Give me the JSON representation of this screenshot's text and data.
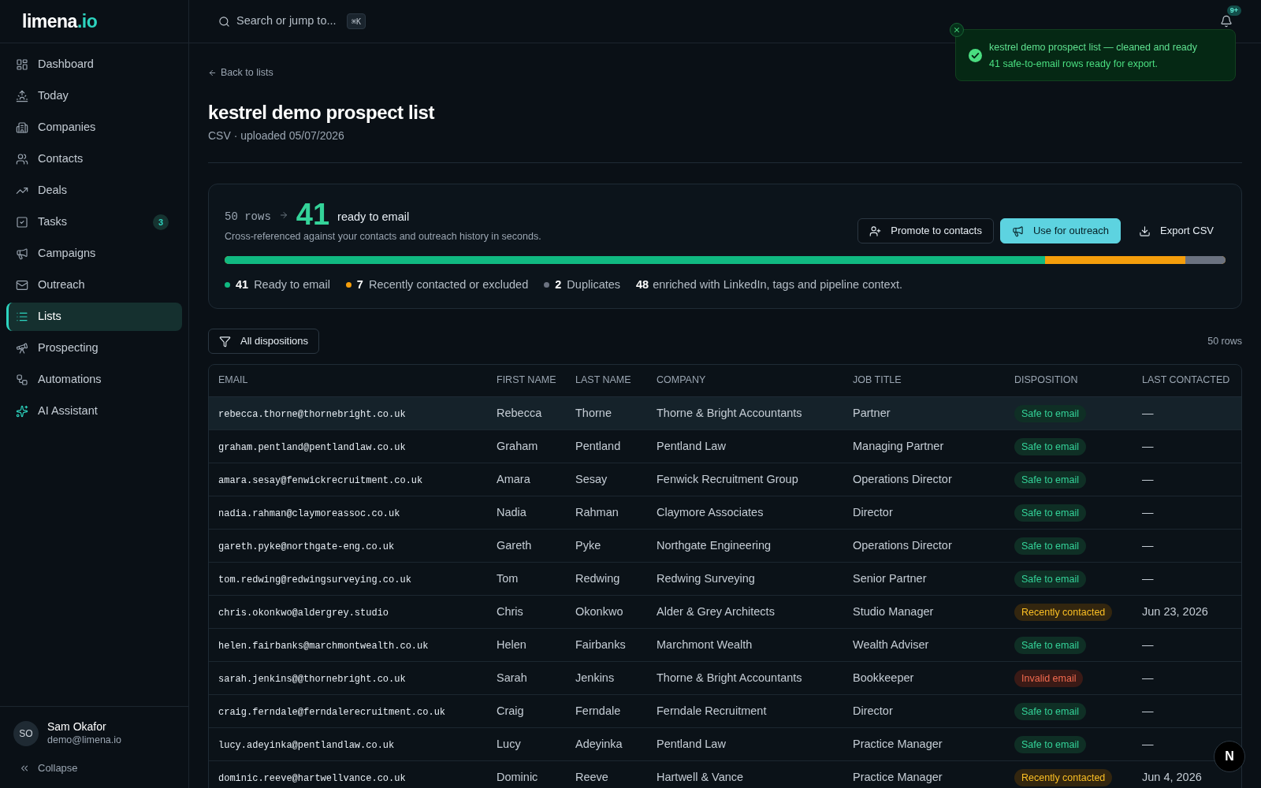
{
  "sidebar": {
    "logo": {
      "name": "limena",
      "suffix": ".io"
    },
    "items": [
      {
        "label": "Dashboard",
        "selected": false
      },
      {
        "label": "Today",
        "selected": false
      },
      {
        "label": "Companies",
        "selected": false
      },
      {
        "label": "Contacts",
        "selected": false
      },
      {
        "label": "Deals",
        "selected": false
      },
      {
        "label": "Tasks",
        "selected": false,
        "badge": "3"
      },
      {
        "label": "Campaigns",
        "selected": false
      },
      {
        "label": "Outreach",
        "selected": false
      },
      {
        "label": "Lists",
        "selected": true
      },
      {
        "label": "Prospecting",
        "selected": false
      },
      {
        "label": "Automations",
        "selected": false
      },
      {
        "label": "AI Assistant",
        "selected": false
      }
    ],
    "user": {
      "initials": "SO",
      "name": "Sam Okafor",
      "email": "demo@limena.io"
    },
    "collapse": "Collapse"
  },
  "topbar": {
    "search": {
      "placeholder": "Search or jump to..."
    },
    "shortcut": "⌘K",
    "notifications": "9+"
  },
  "toast": {
    "title": "kestrel demo prospect list — cleaned and ready",
    "message": "41 safe-to-email rows ready for export."
  },
  "page": {
    "back": "Back to lists",
    "title": "kestrel demo prospect list",
    "subtitle": "CSV · uploaded 05/07/2026"
  },
  "summary": {
    "total": "50 rows",
    "ready": "41",
    "ready_label": "ready to email",
    "note": "Cross-referenced against your contacts and outreach history in seconds.",
    "actions": [
      {
        "label": "Promote to contacts",
        "kind": "outline"
      },
      {
        "label": "Use for outreach",
        "kind": "primary"
      },
      {
        "label": "Export CSV",
        "kind": "ghost"
      }
    ],
    "segments": [
      {
        "count": "41",
        "label": "Ready to email",
        "color": "#10b981",
        "level": 0.82
      },
      {
        "count": "7",
        "label": "Recently contacted or excluded",
        "color": "#f59e0b"
      },
      {
        "count": "2",
        "label": "Duplicates",
        "color": "#6b7280",
        "level": 0.04
      }
    ],
    "enriched": {
      "count": "48",
      "label": "enriched with LinkedIn, tags and pipeline context."
    }
  },
  "filter": {
    "label": "All dispositions"
  },
  "row_count": "50 rows",
  "table": {
    "columns": [
      "EMAIL",
      "FIRST NAME",
      "LAST NAME",
      "COMPANY",
      "JOB TITLE",
      "DISPOSITION",
      "LAST CONTACTED"
    ],
    "rows": [
      {
        "selected": true,
        "email": "rebecca.thorne@thornebright.co.uk",
        "first_name": "Rebecca",
        "last_name": "Thorne",
        "company": "Thorne & Bright Accountants",
        "job_title": "Partner",
        "disposition": {
          "label": "Safe to email",
          "kind": "safe"
        },
        "last_contacted": "—"
      },
      {
        "selected": false,
        "email": "graham.pentland@pentlandlaw.co.uk",
        "first_name": "Graham",
        "last_name": "Pentland",
        "company": "Pentland Law",
        "job_title": "Managing Partner",
        "disposition": {
          "label": "Safe to email",
          "kind": "safe"
        },
        "last_contacted": "—"
      },
      {
        "selected": false,
        "email": "amara.sesay@fenwickrecruitment.co.uk",
        "first_name": "Amara",
        "last_name": "Sesay",
        "company": "Fenwick Recruitment Group",
        "job_title": "Operations Director",
        "disposition": {
          "label": "Safe to email",
          "kind": "safe"
        },
        "last_contacted": "—"
      },
      {
        "selected": false,
        "email": "nadia.rahman@claymoreassoc.co.uk",
        "first_name": "Nadia",
        "last_name": "Rahman",
        "company": "Claymore Associates",
        "job_title": "Director",
        "disposition": {
          "label": "Safe to email",
          "kind": "safe"
        },
        "last_contacted": "—"
      },
      {
        "selected": false,
        "email": "gareth.pyke@northgate-eng.co.uk",
        "first_name": "Gareth",
        "last_name": "Pyke",
        "company": "Northgate Engineering",
        "job_title": "Operations Director",
        "disposition": {
          "label": "Safe to email",
          "kind": "safe"
        },
        "last_contacted": "—"
      },
      {
        "selected": false,
        "email": "tom.redwing@redwingsurveying.co.uk",
        "first_name": "Tom",
        "last_name": "Redwing",
        "company": "Redwing Surveying",
        "job_title": "Senior Partner",
        "disposition": {
          "label": "Safe to email",
          "kind": "safe"
        },
        "last_contacted": "—"
      },
      {
        "selected": false,
        "email": "chris.okonkwo@aldergrey.studio",
        "first_name": "Chris",
        "last_name": "Okonkwo",
        "company": "Alder & Grey Architects",
        "job_title": "Studio Manager",
        "disposition": {
          "label": "Recently contacted",
          "kind": "recent"
        },
        "last_contacted": "Jun 23, 2026"
      },
      {
        "selected": false,
        "email": "helen.fairbanks@marchmontwealth.co.uk",
        "first_name": "Helen",
        "last_name": "Fairbanks",
        "company": "Marchmont Wealth",
        "job_title": "Wealth Adviser",
        "disposition": {
          "label": "Safe to email",
          "kind": "safe"
        },
        "last_contacted": "—"
      },
      {
        "selected": false,
        "email": "sarah.jenkins@@thornebright.co.uk",
        "first_name": "Sarah",
        "last_name": "Jenkins",
        "company": "Thorne & Bright Accountants",
        "job_title": "Bookkeeper",
        "disposition": {
          "label": "Invalid email",
          "kind": "invalid"
        },
        "last_contacted": "—"
      },
      {
        "selected": false,
        "email": "craig.ferndale@ferndalerecruitment.co.uk",
        "first_name": "Craig",
        "last_name": "Ferndale",
        "company": "Ferndale Recruitment",
        "job_title": "Director",
        "disposition": {
          "label": "Safe to email",
          "kind": "safe"
        },
        "last_contacted": "—"
      },
      {
        "selected": false,
        "email": "lucy.adeyinka@pentlandlaw.co.uk",
        "first_name": "Lucy",
        "last_name": "Adeyinka",
        "company": "Pentland Law",
        "job_title": "Practice Manager",
        "disposition": {
          "label": "Safe to email",
          "kind": "safe"
        },
        "last_contacted": "—"
      },
      {
        "selected": false,
        "email": "dominic.reeve@hartwellvance.co.uk",
        "first_name": "Dominic",
        "last_name": "Reeve",
        "company": "Hartwell & Vance",
        "job_title": "Practice Manager",
        "disposition": {
          "label": "Recently contacted",
          "kind": "recent"
        },
        "last_contacted": "Jun 4, 2026"
      }
    ]
  },
  "dev_badge": "N"
}
